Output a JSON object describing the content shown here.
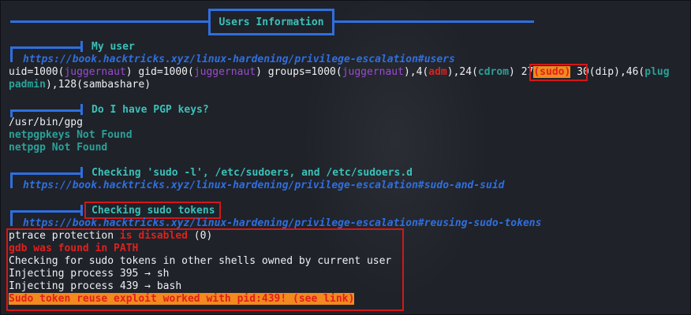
{
  "colors": {
    "background": "#1f2229",
    "accent_blue": "#2f6fe0",
    "heading": "#3cc0b8",
    "warning_red": "#e0201c",
    "highlight_orange": "#f28a1e",
    "group_purple": "#9a4bd0"
  },
  "header": {
    "title": "Users Information"
  },
  "sections": {
    "my_user": {
      "heading": "My user",
      "link": "https://book.hacktricks.xyz/linux-hardening/privilege-escalation#users",
      "id_line": {
        "p1": "uid=1000(",
        "user1": "juggernaut",
        "p2": ") gid=1000(",
        "user2": "juggernaut",
        "p3": ") groups=1000(",
        "user3": "juggernaut",
        "p4": "),4(",
        "adm": "adm",
        "p5": "),24(",
        "cdrom": "cdrom",
        "p6": ") ",
        "sudo_num": "27",
        "sudo": "(sudo)",
        "p7": " 30(dip),46(",
        "plug": "plug"
      },
      "id_line2": {
        "plugdev": "padmin",
        "rest": "),128(sambashare)"
      }
    },
    "pgp": {
      "heading": "Do I have PGP keys?",
      "lines": [
        "/usr/bin/gpg",
        "netpgpkeys Not Found",
        "netpgp Not Found"
      ]
    },
    "sudo_l": {
      "heading": "Checking 'sudo -l', /etc/sudoers, and /etc/sudoers.d",
      "link": "https://book.hacktricks.xyz/linux-hardening/privilege-escalation#sudo-and-suid"
    },
    "sudo_tokens": {
      "heading": "Checking sudo tokens",
      "link": "https://book.hacktricks.xyz/linux-hardening/privilege-escalation#reusing-sudo-tokens",
      "ptrace_a": "ptrace protection ",
      "ptrace_b": "is disabled",
      "ptrace_c": " (0)",
      "gdb": "gdb was found in PATH",
      "checking": "Checking for sudo tokens in other shells owned by current user",
      "inject1": "Injecting process 395 → sh",
      "inject2": "Injecting process 439 → bash",
      "result": "Sudo token reuse exploit worked with pid:439! (see link)"
    }
  }
}
